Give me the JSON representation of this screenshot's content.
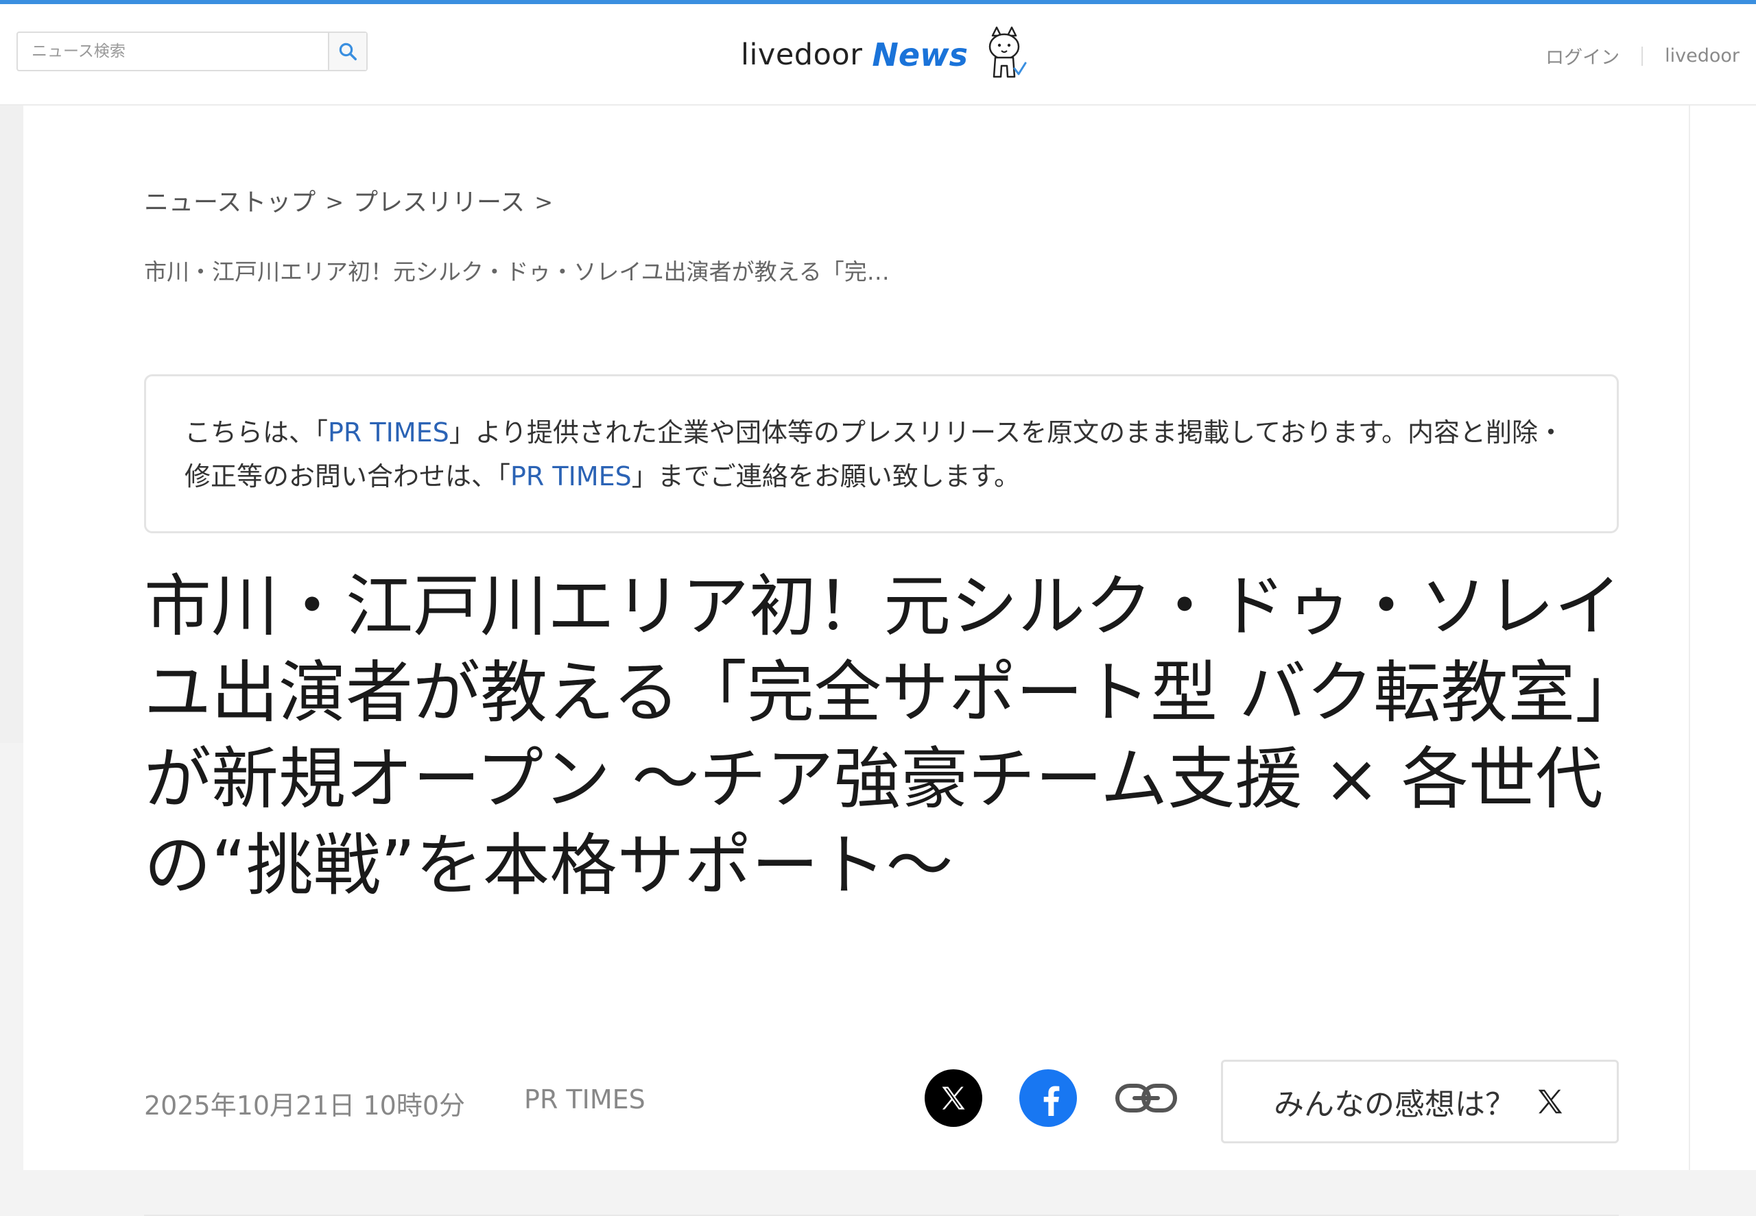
{
  "header": {
    "search_placeholder": "ニュース検索",
    "logo_primary": "livedoor",
    "logo_secondary": "News",
    "login_label": "ログイン",
    "livedoor_label": "livedoor"
  },
  "breadcrumb": {
    "items": [
      "ニューストップ",
      "プレスリリース"
    ],
    "separator": ">",
    "current_title": "市川・江戸川エリア初！元シルク・ドゥ・ソレイユ出演者が教える「完…"
  },
  "notice": {
    "text_1": "こちらは、「",
    "link_1": "PR TIMES",
    "text_2": "」より提供された企業や団体等のプレスリリースを原文のまま掲載しております。内容と削除・修正等のお問い合わせは、「",
    "link_2": "PR TIMES",
    "text_3": "」までご連絡をお願い致します。"
  },
  "article": {
    "title": "市川・江戸川エリア初！元シルク・ドゥ・ソレイユ出演者が教える「完全サポート型 バク転教室」が新規オープン ～チア強豪チーム支援 × 各世代の“挑戦”を本格サポート～",
    "date": "2025年10月21日 10時0分",
    "source": "PR TIMES"
  },
  "share": {
    "icons": [
      "x-share-icon",
      "facebook-share-icon",
      "copy-link-icon"
    ],
    "opinion_label": "みんなの感想は？"
  },
  "colors": {
    "accent_bar": "#3a8fe0",
    "news_logo": "#1a73d9",
    "link": "#2b63b5",
    "facebook": "#1877f2"
  }
}
